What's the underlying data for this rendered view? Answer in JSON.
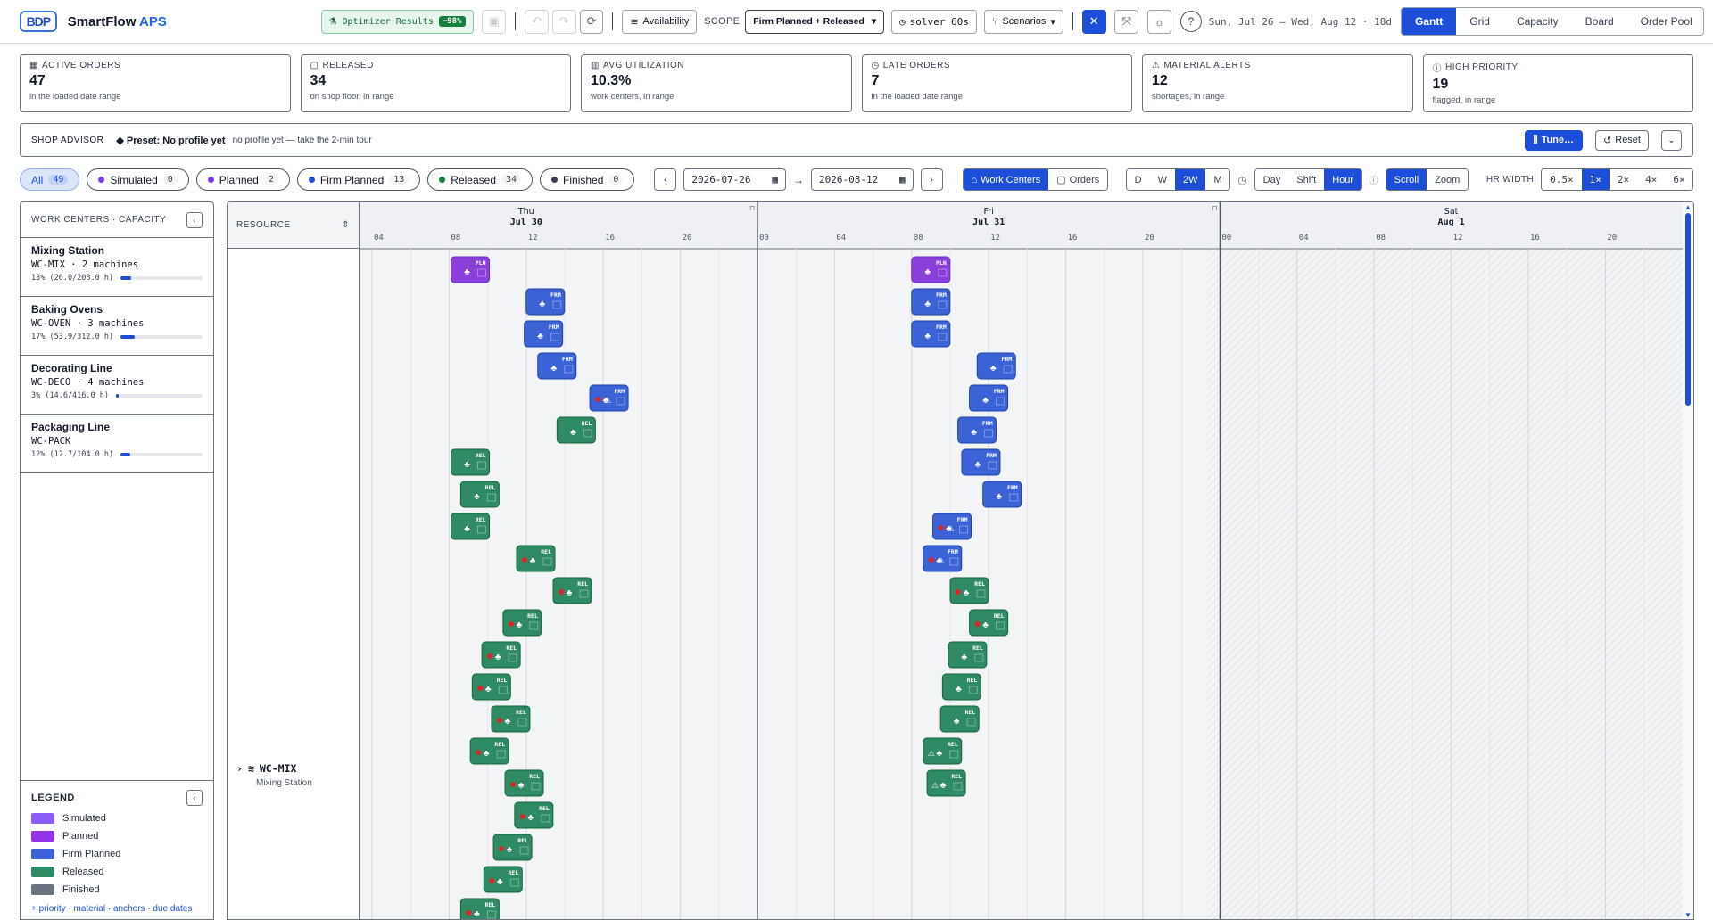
{
  "app": {
    "logo_text": "BDP",
    "name": "SmartFlow",
    "name_accent": "APS"
  },
  "toolbar": {
    "optimizer_label": "Optimizer Results",
    "optimizer_badge": "−98%",
    "availability_label": "Availability",
    "scope_label": "SCOPE",
    "scope_value": "Firm Planned + Released",
    "solver_label": "solver 60s",
    "scenarios_label": "Scenarios",
    "date_range": "Sun, Jul 26 – Wed, Aug 12 · 18d"
  },
  "view_tabs": [
    {
      "label": "Gantt",
      "active": true
    },
    {
      "label": "Grid",
      "active": false
    },
    {
      "label": "Capacity",
      "active": false
    },
    {
      "label": "Board",
      "active": false
    },
    {
      "label": "Order Pool",
      "active": false
    }
  ],
  "kpis": [
    {
      "label": "ACTIVE ORDERS",
      "icon": "calendar-icon",
      "value": "47",
      "sub": "in the loaded date range"
    },
    {
      "label": "RELEASED",
      "icon": "box-icon",
      "value": "34",
      "sub": "on shop floor, in range"
    },
    {
      "label": "AVG UTILIZATION",
      "icon": "bar-chart-icon",
      "value": "10.3%",
      "sub": "work centers, in range"
    },
    {
      "label": "LATE ORDERS",
      "icon": "clock-icon",
      "value": "7",
      "sub": "in the loaded date range"
    },
    {
      "label": "MATERIAL ALERTS",
      "icon": "warning-icon",
      "value": "12",
      "sub": "shortages, in range"
    },
    {
      "label": "HIGH PRIORITY",
      "icon": "alert-circle-icon",
      "value": "19",
      "sub": "flagged, in range"
    }
  ],
  "advisor": {
    "title": "SHOP ADVISOR",
    "preset": "◆ Preset: No profile yet",
    "note": "no profile yet — take the 2-min tour",
    "tune_label": "Tune…",
    "reset_label": "Reset"
  },
  "filters": [
    {
      "label": "All",
      "count": "49",
      "color": "",
      "active": true
    },
    {
      "label": "Simulated",
      "count": "0",
      "color": "#7c3aed",
      "active": false
    },
    {
      "label": "Planned",
      "count": "2",
      "color": "#7c3aed",
      "active": false
    },
    {
      "label": "Firm Planned",
      "count": "13",
      "color": "#1d4ed8",
      "active": false
    },
    {
      "label": "Released",
      "count": "34",
      "color": "#15803d",
      "active": false
    },
    {
      "label": "Finished",
      "count": "0",
      "color": "#374151",
      "active": false
    }
  ],
  "date_from": "2026-07-26",
  "date_to": "2026-08-12",
  "group_seg": [
    {
      "label": "Work Centers",
      "active": true
    },
    {
      "label": "Orders",
      "active": false
    }
  ],
  "range_seg": [
    {
      "label": "D",
      "active": false
    },
    {
      "label": "W",
      "active": false
    },
    {
      "label": "2W",
      "active": true
    },
    {
      "label": "M",
      "active": false
    }
  ],
  "unit_seg": [
    {
      "label": "Day",
      "active": false
    },
    {
      "label": "Shift",
      "active": false
    },
    {
      "label": "Hour",
      "active": true
    }
  ],
  "mode_seg": [
    {
      "label": "Scroll",
      "active": true
    },
    {
      "label": "Zoom",
      "active": false
    }
  ],
  "hr_width_label": "HR WIDTH",
  "hr_width_seg": [
    {
      "label": "0.5×",
      "active": false
    },
    {
      "label": "1×",
      "active": true
    },
    {
      "label": "2×",
      "active": false
    },
    {
      "label": "4×",
      "active": false
    },
    {
      "label": "6×",
      "active": false
    }
  ],
  "sidebar": {
    "title": "WORK CENTERS · CAPACITY",
    "work_centers": [
      {
        "name": "Mixing Station",
        "code": "WC-MIX",
        "machines": "2 machines",
        "util_text": "13% (26.0/208.0 h)",
        "util": 0.13
      },
      {
        "name": "Baking Ovens",
        "code": "WC-OVEN",
        "machines": "3 machines",
        "util_text": "17% (53.9/312.0 h)",
        "util": 0.17
      },
      {
        "name": "Decorating Line",
        "code": "WC-DECO",
        "machines": "4 machines",
        "util_text": "3% (14.6/416.0 h)",
        "util": 0.03
      },
      {
        "name": "Packaging Line",
        "code": "WC-PACK",
        "machines": "",
        "util_text": "12% (12.7/104.0 h)",
        "util": 0.12
      }
    ]
  },
  "legend": {
    "title": "LEGEND",
    "items": [
      {
        "label": "Simulated",
        "color": "#8b5cf6"
      },
      {
        "label": "Planned",
        "color": "#9333ea"
      },
      {
        "label": "Firm Planned",
        "color": "#3b63d6"
      },
      {
        "label": "Released",
        "color": "#2f8a66"
      },
      {
        "label": "Finished",
        "color": "#6b7280"
      }
    ],
    "more": "+ priority · material · anchors · due dates"
  },
  "gantt": {
    "resource_header": "RESOURCE",
    "resource_code": "WC-MIX",
    "resource_desc": "Mixing Station",
    "days": [
      {
        "weekday": "Thu",
        "date": "Jul 30"
      },
      {
        "weekday": "Fri",
        "date": "Jul 31"
      },
      {
        "weekday": "Sat",
        "date": "Aug 1"
      }
    ],
    "hour_ticks": [
      "00",
      "04",
      "08",
      "12",
      "16",
      "20"
    ]
  },
  "status_colors": {
    "PLN": {
      "fill": "#8b3fd9",
      "stroke": "#6d28d9"
    },
    "FRM": {
      "fill": "#3b63d6",
      "stroke": "#1e40af"
    },
    "REL": {
      "fill": "#2f8a66",
      "stroke": "#166534"
    }
  },
  "bars": [
    {
      "day": 0,
      "hour": 8.1,
      "status": "PLN",
      "late": false,
      "warn": false
    },
    {
      "day": 0,
      "hour": 12.0,
      "status": "FRM",
      "late": false,
      "warn": false
    },
    {
      "day": 0,
      "hour": 11.9,
      "status": "FRM",
      "late": false,
      "warn": false
    },
    {
      "day": 0,
      "hour": 12.6,
      "status": "FRM",
      "late": false,
      "warn": false
    },
    {
      "day": 0,
      "hour": 15.3,
      "status": "FRM",
      "late": true,
      "warn": true
    },
    {
      "day": 0,
      "hour": 13.6,
      "status": "REL",
      "late": false,
      "warn": false
    },
    {
      "day": 0,
      "hour": 8.1,
      "status": "REL",
      "late": false,
      "warn": false
    },
    {
      "day": 0,
      "hour": 8.6,
      "status": "REL",
      "late": false,
      "warn": false
    },
    {
      "day": 0,
      "hour": 8.1,
      "status": "REL",
      "late": false,
      "warn": false
    },
    {
      "day": 0,
      "hour": 11.5,
      "status": "REL",
      "late": true,
      "warn": false
    },
    {
      "day": 0,
      "hour": 13.4,
      "status": "REL",
      "late": true,
      "warn": false
    },
    {
      "day": 0,
      "hour": 10.8,
      "status": "REL",
      "late": true,
      "warn": false
    },
    {
      "day": 0,
      "hour": 9.7,
      "status": "REL",
      "late": true,
      "warn": false
    },
    {
      "day": 0,
      "hour": 9.2,
      "status": "REL",
      "late": true,
      "warn": false
    },
    {
      "day": 0,
      "hour": 10.2,
      "status": "REL",
      "late": true,
      "warn": false
    },
    {
      "day": 0,
      "hour": 9.1,
      "status": "REL",
      "late": true,
      "warn": false
    },
    {
      "day": 0,
      "hour": 10.9,
      "status": "REL",
      "late": true,
      "warn": false
    },
    {
      "day": 0,
      "hour": 11.4,
      "status": "REL",
      "late": true,
      "warn": false
    },
    {
      "day": 0,
      "hour": 10.3,
      "status": "REL",
      "late": true,
      "warn": false
    },
    {
      "day": 0,
      "hour": 9.8,
      "status": "REL",
      "late": true,
      "warn": false
    },
    {
      "day": 0,
      "hour": 8.6,
      "status": "REL",
      "late": true,
      "warn": false
    },
    {
      "day": 1,
      "hour": 8.0,
      "status": "PLN",
      "late": false,
      "warn": false
    },
    {
      "day": 1,
      "hour": 8.0,
      "status": "FRM",
      "late": false,
      "warn": false
    },
    {
      "day": 1,
      "hour": 8.0,
      "status": "FRM",
      "late": false,
      "warn": false
    },
    {
      "day": 1,
      "hour": 11.4,
      "status": "FRM",
      "late": false,
      "warn": false
    },
    {
      "day": 1,
      "hour": 11.0,
      "status": "FRM",
      "late": false,
      "warn": false
    },
    {
      "day": 1,
      "hour": 10.4,
      "status": "FRM",
      "late": false,
      "warn": false
    },
    {
      "day": 1,
      "hour": 10.6,
      "status": "FRM",
      "late": false,
      "warn": false
    },
    {
      "day": 1,
      "hour": 11.7,
      "status": "FRM",
      "late": false,
      "warn": false
    },
    {
      "day": 1,
      "hour": 9.1,
      "status": "FRM",
      "late": true,
      "warn": true
    },
    {
      "day": 1,
      "hour": 8.6,
      "status": "FRM",
      "late": true,
      "warn": true
    },
    {
      "day": 1,
      "hour": 10.0,
      "status": "REL",
      "late": true,
      "warn": false
    },
    {
      "day": 1,
      "hour": 11.0,
      "status": "REL",
      "late": true,
      "warn": false
    },
    {
      "day": 1,
      "hour": 9.9,
      "status": "REL",
      "late": false,
      "warn": false
    },
    {
      "day": 1,
      "hour": 9.6,
      "status": "REL",
      "late": false,
      "warn": false
    },
    {
      "day": 1,
      "hour": 9.5,
      "status": "REL",
      "late": false,
      "warn": false
    },
    {
      "day": 1,
      "hour": 8.6,
      "status": "REL",
      "late": false,
      "warn": true
    },
    {
      "day": 1,
      "hour": 8.8,
      "status": "REL",
      "late": false,
      "warn": true
    }
  ]
}
